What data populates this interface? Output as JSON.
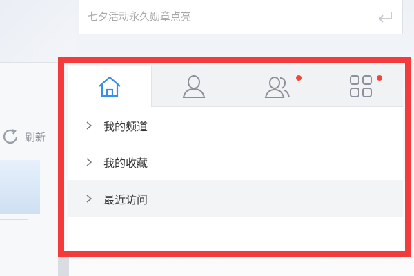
{
  "search": {
    "placeholder": "七夕活动永久勋章点亮"
  },
  "left": {
    "refresh_label": "刷新"
  },
  "tabs": [
    {
      "icon": "home-icon",
      "active": true
    },
    {
      "icon": "user-icon",
      "active": false
    },
    {
      "icon": "friends-icon",
      "active": false,
      "badge": true
    },
    {
      "icon": "grid-apps-icon",
      "active": false,
      "badge": true
    }
  ],
  "menu": {
    "items": [
      {
        "label": "我的频道"
      },
      {
        "label": "我的收藏"
      },
      {
        "label": "最近访问"
      }
    ]
  },
  "colors": {
    "highlight": "#f33b3b",
    "badge": "#f2463b",
    "accent": "#3a8ee6"
  }
}
